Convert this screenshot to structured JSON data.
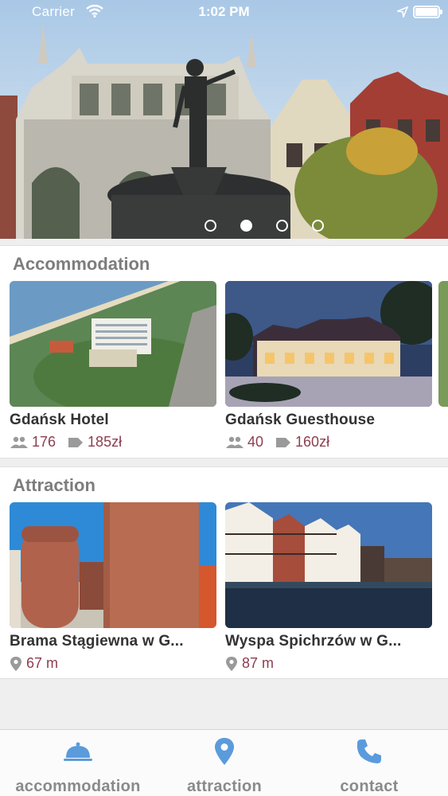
{
  "status_bar": {
    "carrier": "Carrier",
    "time": "1:02 PM"
  },
  "hero": {
    "slide_count": 4,
    "active_index": 1
  },
  "accommodation": {
    "title": "Accommodation",
    "items": [
      {
        "name": "Gdańsk Hotel",
        "capacity": "176",
        "price": "185zł"
      },
      {
        "name": "Gdańsk Guesthouse",
        "capacity": "40",
        "price": "160zł"
      }
    ]
  },
  "attraction": {
    "title": "Attraction",
    "items": [
      {
        "name": "Brama Stągiewna w G...",
        "distance": "67 m"
      },
      {
        "name": "Wyspa Spichrzów w G...",
        "distance": "87 m"
      }
    ]
  },
  "tabbar": {
    "tabs": [
      {
        "label": "accommodation",
        "icon": "cloche-icon"
      },
      {
        "label": "attraction",
        "icon": "map-pin-icon"
      },
      {
        "label": "contact",
        "icon": "phone-icon"
      }
    ]
  },
  "colors": {
    "accent_blue": "#5b9bdc",
    "price_red": "#8d3d4f",
    "tab_gray": "#8a8a8a"
  }
}
